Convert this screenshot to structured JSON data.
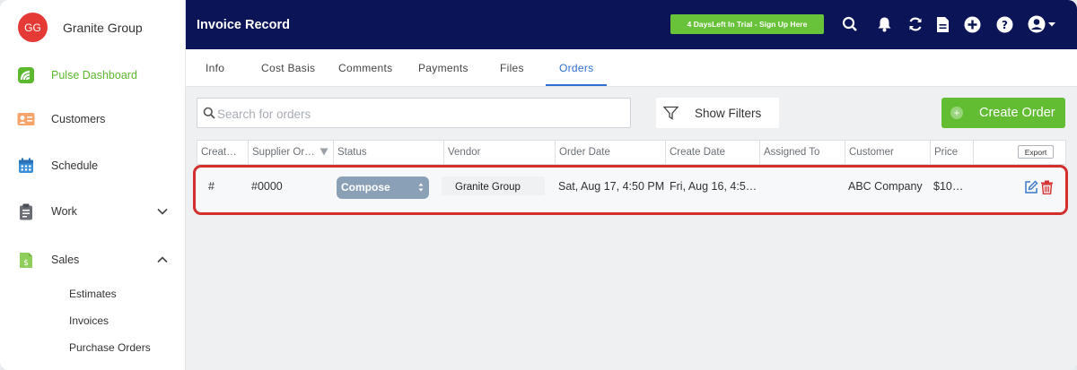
{
  "sidebar": {
    "avatar_initials": "GG",
    "company_name": "Granite Group",
    "items": [
      {
        "label": "Pulse Dashboard",
        "icon": "pulse-logo-icon"
      },
      {
        "label": "Customers",
        "icon": "contact-card-icon"
      },
      {
        "label": "Schedule",
        "icon": "calendar-icon"
      },
      {
        "label": "Work",
        "icon": "clipboard-icon"
      },
      {
        "label": "Sales",
        "icon": "dollar-document-icon"
      }
    ],
    "sales_subitems": [
      "Estimates",
      "Invoices",
      "Purchase Orders"
    ]
  },
  "header": {
    "title": "Invoice Record",
    "trial_button": "4 DaysLeft In Trial - Sign Up Here",
    "icons": [
      "search-icon",
      "bell-icon",
      "sync-icon",
      "document-icon",
      "add-circle-icon",
      "help-icon",
      "user-account-icon"
    ]
  },
  "tabs": [
    {
      "label": "Info"
    },
    {
      "label": "Cost Basis"
    },
    {
      "label": "Comments"
    },
    {
      "label": "Payments"
    },
    {
      "label": "Files"
    },
    {
      "label": "Orders",
      "active": true
    }
  ],
  "toolbar": {
    "search_placeholder": "Search for orders",
    "filters_label": "Show Filters",
    "create_label": "Create Order"
  },
  "table": {
    "columns": [
      "Creat…",
      "Supplier Or…",
      "Status",
      "Vendor",
      "Order Date",
      "Create Date",
      "Assigned To",
      "Customer",
      "Price"
    ],
    "export_label": "Export",
    "rows": [
      {
        "created": "#",
        "supplier_order": "#0000",
        "status": "Compose",
        "vendor": "Granite Group",
        "order_date": "Sat, Aug 17, 4:50 PM",
        "create_date": "Fri, Aug 16, 4:5…",
        "assigned_to": "",
        "customer": "ABC Company",
        "price": "$10…"
      }
    ]
  },
  "colors": {
    "header_bg": "#0b1457",
    "accent_green": "#62bd33",
    "active_tab": "#2f6fd0",
    "highlight_red": "#d32f2f",
    "status_pill": "#8aa0b6"
  }
}
